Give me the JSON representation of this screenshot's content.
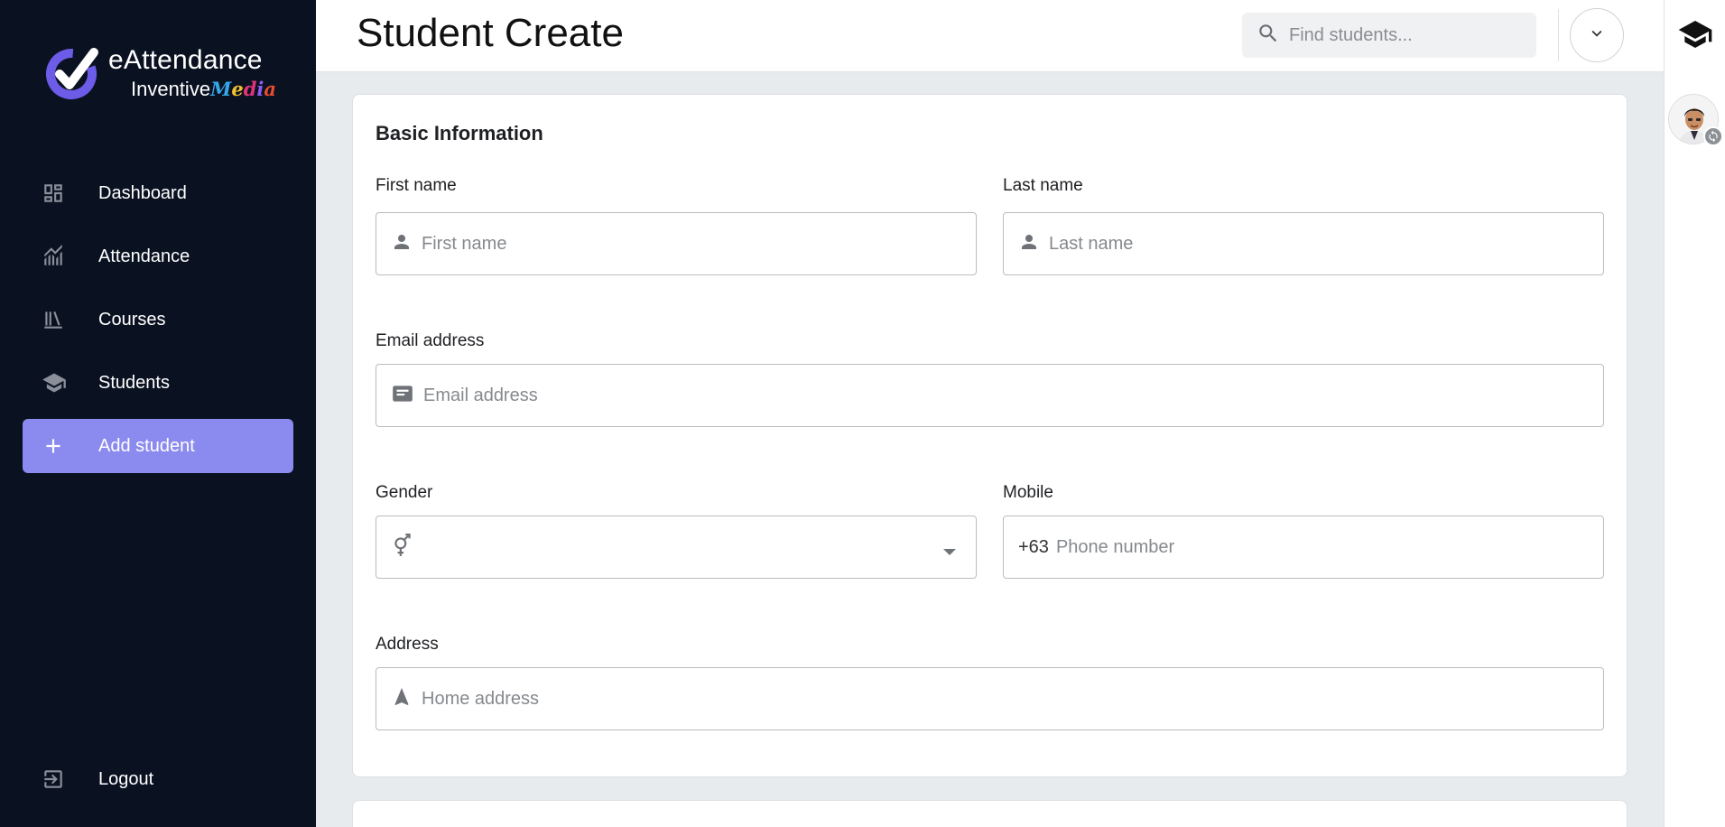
{
  "brand": {
    "title": "eAttendance",
    "subtitle_plain": "Inventive",
    "subtitle_accent": [
      "M",
      "e",
      "d",
      "i",
      "a"
    ],
    "accent_colors": [
      "#35a7e8",
      "#f2c12e",
      "#e0347a",
      "#8e5cf0",
      "#e84d2c"
    ]
  },
  "sidebar": {
    "items": [
      {
        "label": "Dashboard",
        "icon": "dashboard-icon",
        "active": false
      },
      {
        "label": "Attendance",
        "icon": "chart-icon",
        "active": false
      },
      {
        "label": "Courses",
        "icon": "books-icon",
        "active": false
      },
      {
        "label": "Students",
        "icon": "school-icon",
        "active": false
      },
      {
        "label": "Add student",
        "icon": "plus-icon",
        "active": true
      }
    ],
    "logout_label": "Logout",
    "active_color": "#8b8aee"
  },
  "header": {
    "title": "Student Create",
    "search_placeholder": "Find students..."
  },
  "form": {
    "section_title": "Basic Information",
    "first_name": {
      "label": "First name",
      "placeholder": "First name",
      "value": ""
    },
    "last_name": {
      "label": "Last name",
      "placeholder": "Last name",
      "value": ""
    },
    "email": {
      "label": "Email address",
      "placeholder": "Email address",
      "value": ""
    },
    "gender": {
      "label": "Gender",
      "value": ""
    },
    "mobile": {
      "label": "Mobile",
      "prefix": "+63",
      "placeholder": "Phone number",
      "value": ""
    },
    "address": {
      "label": "Address",
      "placeholder": "Home address",
      "value": ""
    }
  }
}
